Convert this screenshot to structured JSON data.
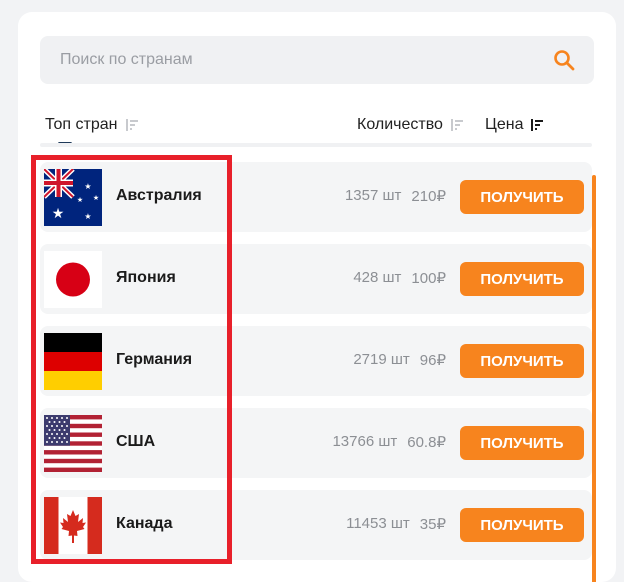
{
  "search": {
    "placeholder": "Поиск по странам",
    "icon": "search-icon"
  },
  "header": {
    "top_label": "Топ стран",
    "qty_label": "Количество",
    "price_label": "Цена"
  },
  "accent": "#f7841e",
  "countries": [
    {
      "name": "Австралия",
      "qty": "1357 шт",
      "price": "210₽",
      "button": "ПОЛУЧИТЬ",
      "flag": "australia-flag-icon"
    },
    {
      "name": "Япония",
      "qty": "428 шт",
      "price": "100₽",
      "button": "ПОЛУЧИТЬ",
      "flag": "japan-flag-icon"
    },
    {
      "name": "Германия",
      "qty": "2719 шт",
      "price": "96₽",
      "button": "ПОЛУЧИТЬ",
      "flag": "germany-flag-icon"
    },
    {
      "name": "США",
      "qty": "13766 шт",
      "price": "60.8₽",
      "button": "ПОЛУЧИТЬ",
      "flag": "usa-flag-icon"
    },
    {
      "name": "Канада",
      "qty": "11453 шт",
      "price": "35₽",
      "button": "ПОЛУЧИТЬ",
      "flag": "canada-flag-icon"
    }
  ]
}
